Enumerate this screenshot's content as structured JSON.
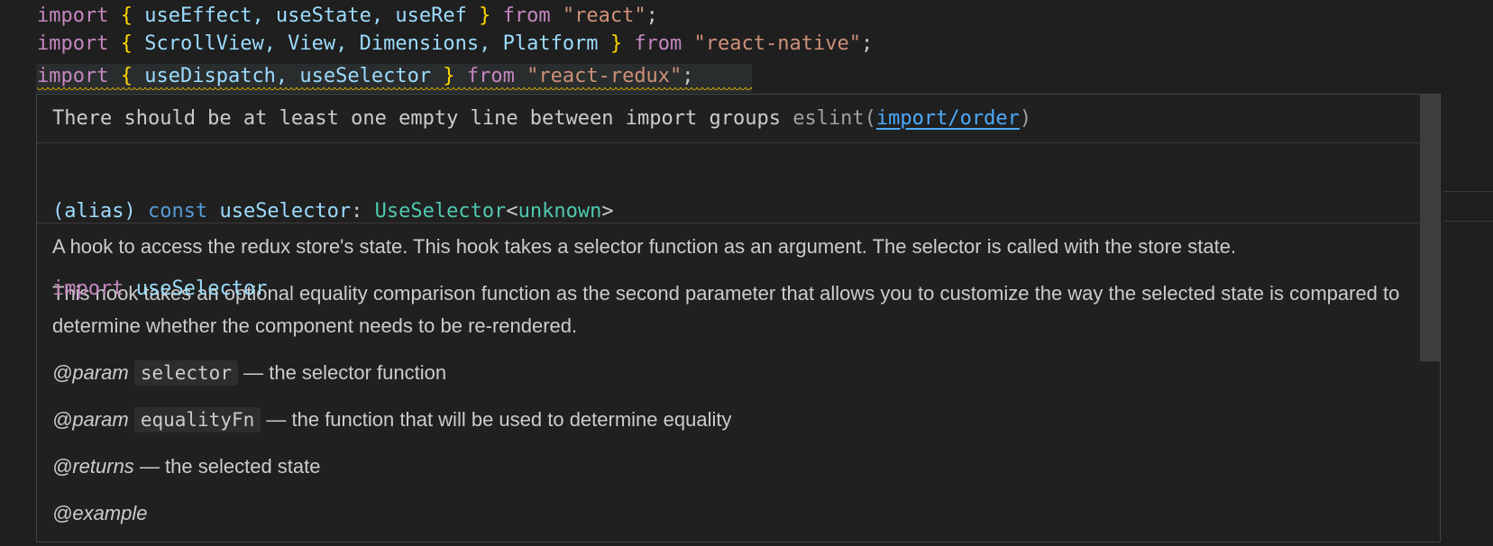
{
  "editor": {
    "lines": [
      {
        "kw1": "import",
        "open": "{",
        "names": "useEffect, useState, useRef",
        "close": "}",
        "kw2": "from",
        "module": "\"react\"",
        "semi": ";"
      },
      {
        "kw1": "import",
        "open": "{",
        "names": "ScrollView, View, Dimensions, Platform",
        "close": "}",
        "kw2": "from",
        "module": "\"react-native\"",
        "semi": ";"
      },
      {
        "kw1": "import",
        "open": "{",
        "names": "useDispatch, useSelector",
        "close": "}",
        "kw2": "from",
        "module": "\"react-redux\"",
        "semi": ";"
      }
    ]
  },
  "hover": {
    "diagnostic": {
      "message": "There should be at least one empty line between import groups",
      "source_prefix": "eslint(",
      "rule_link": "import/order",
      "source_suffix": ")"
    },
    "signature": {
      "alias": "(alias)",
      "const_kw": "const",
      "name": "useSelector",
      "colon": ":",
      "type_name": "UseSelector",
      "lt": "<",
      "type_arg": "unknown",
      "gt": ">",
      "import_kw": "import",
      "import_name": "useSelector"
    },
    "doc": {
      "para1": "A hook to access the redux store's state. This hook takes a selector function as an argument. The selector is called with the store state.",
      "para2": "This hook takes an optional equality comparison function as the second parameter that allows you to customize the way the selected state is compared to determine whether the component needs to be re-rendered.",
      "params": [
        {
          "tag": "@param",
          "name": "selector",
          "desc": "— the selector function"
        },
        {
          "tag": "@param",
          "name": "equalityFn",
          "desc": "— the function that will be used to determine equality"
        }
      ],
      "returns": {
        "tag": "@returns",
        "desc": "— the selected state"
      },
      "example": {
        "tag": "@example"
      }
    }
  },
  "colors": {
    "background": "#1f1f1f",
    "hover_background": "#202020",
    "keyword": "#c586c0",
    "brace": "#ffd700",
    "identifier": "#9cdcfe",
    "string": "#ce9178",
    "type": "#4ec9b0",
    "link": "#4daafc",
    "squiggle_warning": "#cca700"
  }
}
